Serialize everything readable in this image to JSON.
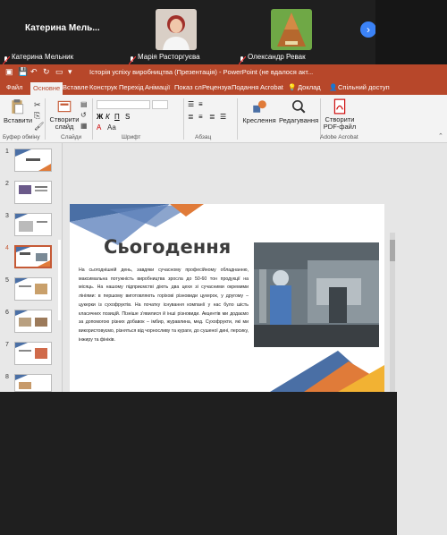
{
  "meeting": {
    "main_participant": "Катерина  Мель...",
    "participants": [
      {
        "name": "Катерина Мельник"
      },
      {
        "name": "Марія Расторгуєва"
      },
      {
        "name": "Олександр Ревак"
      }
    ]
  },
  "window": {
    "title": "Історія успіху виробництва (Презентація)  -  PowerPoint (не вдалося акт..."
  },
  "tabs": [
    "Файл",
    "Основне",
    "Вставле",
    "Конструк",
    "Перехід",
    "Анімації",
    "Показ сл",
    "Рецензуа",
    "Подання",
    "Acrobat"
  ],
  "tab_extras": {
    "tell": "Доклад",
    "share": "Спільний доступ"
  },
  "ribbon": {
    "paste": "Вставити",
    "new_slide": "Створити слайд",
    "drawing": "Креслення",
    "editing": "Редагування",
    "create_pdf": "Створити PDF-файл",
    "groups": {
      "clipboard": "Буфер обміну",
      "slides": "Слайди",
      "font": "Шрифт",
      "paragraph": "Абзац",
      "acrobat": "Adobe Acrobat"
    }
  },
  "thumbnails": [
    "1",
    "2",
    "3",
    "4",
    "5",
    "6",
    "7",
    "8"
  ],
  "slide": {
    "title": "Сьогодення",
    "body": "На сьогоднішній день, завдяки сучасному професійному обладнанню, максимальна потужність виробництва зросла до 50-60 тон продукції на місяць. На нашому підприємстві діють два цехи зі сучасними окремими лініями: в першому виготовляють горіхові різновиди цукерок, у другому – цукерки із сухофруктів. На початку існування компанії у нас було шість класичних позицій. Пізніше з'явилися й інші різновиди. Акцентів ми додаємо за допомогою різних добавок – імбир, журавлина, мед. Сухофрукти, які ми використовуємо, різняться від чорносливу та кураги, до сушеної дині, персику, інжиру та фініків."
  },
  "colors": {
    "accent": "#b7472a",
    "slide_blue": "#4a6fa5",
    "slide_orange": "#e07b39"
  }
}
